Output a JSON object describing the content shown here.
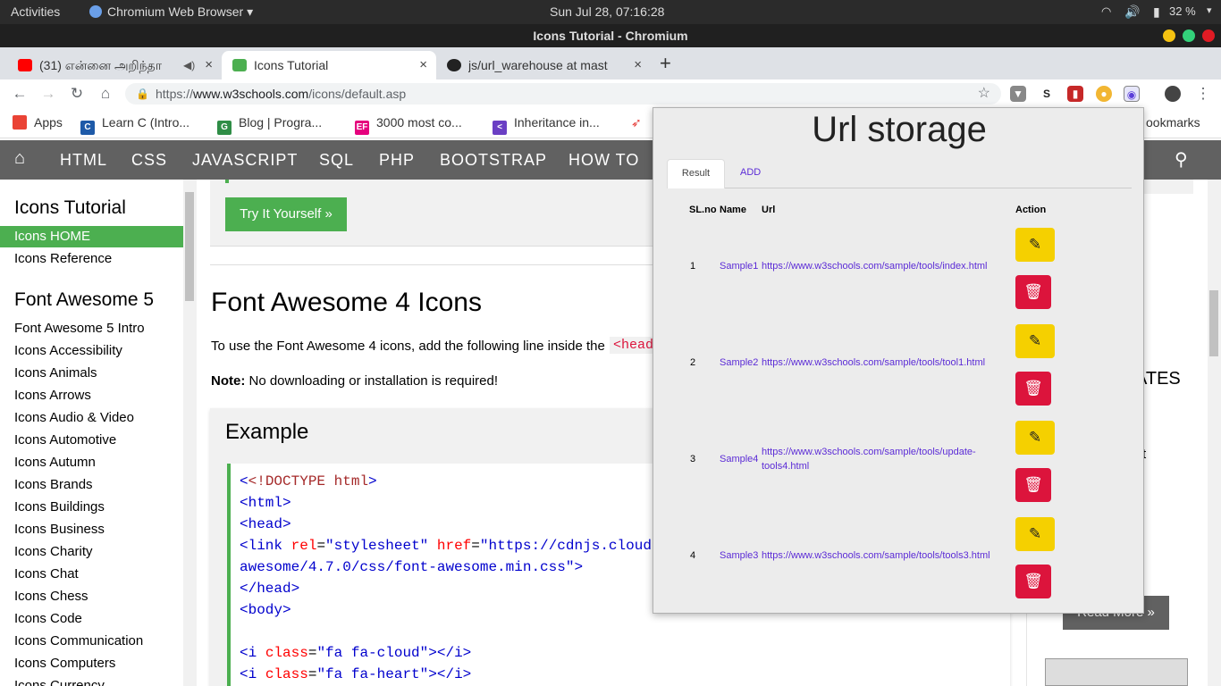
{
  "system": {
    "activities": "Activities",
    "app": "Chromium Web Browser",
    "clock": "Sun Jul 28, 07:16:28",
    "battery": "32 %"
  },
  "window": {
    "title": "Icons Tutorial - Chromium"
  },
  "tabs": [
    {
      "title": "(31) என்னை அறிந்தா",
      "close": "×"
    },
    {
      "title": "Icons Tutorial",
      "close": "×"
    },
    {
      "title": "js/url_warehouse at mast",
      "close": "×"
    }
  ],
  "newtab": "+",
  "omnibox": {
    "scheme": "https://",
    "host": "www.w3schools.com",
    "path": "/icons/default.asp"
  },
  "bookmarks": [
    "Apps",
    "Learn C (Intro...",
    "Blog | Progra...",
    "3000 most co...",
    "Inheritance in...",
    "ookmarks"
  ],
  "w3nav": [
    "HTML",
    "CSS",
    "JAVASCRIPT",
    "SQL",
    "PHP",
    "BOOTSTRAP",
    "HOW TO"
  ],
  "sidebar": {
    "heading1": "Icons Tutorial",
    "items1": [
      "Icons HOME",
      "Icons Reference"
    ],
    "heading2": "Font Awesome 5",
    "items2": [
      "Font Awesome 5 Intro",
      "Icons Accessibility",
      "Icons Animals",
      "Icons Arrows",
      "Icons Audio & Video",
      "Icons Automotive",
      "Icons Autumn",
      "Icons Brands",
      "Icons Buildings",
      "Icons Business",
      "Icons Charity",
      "Icons Chat",
      "Icons Chess",
      "Icons Code",
      "Icons Communication",
      "Icons Computers",
      "Icons Currency"
    ]
  },
  "main": {
    "try_button": "Try It Yourself »",
    "heading": "Font Awesome 4 Icons",
    "intro": "To use the Font Awesome 4 icons, add the following line inside the",
    "intro_code": "<head",
    "note_label": "Note:",
    "note_text": "No downloading or installation is required!",
    "example": "Example",
    "right_partial": {
      "e": "E",
      "ates": "ATES",
      "t": "t",
      "readmore": "Read More »"
    }
  },
  "code": {
    "doctype": "<!DOCTYPE",
    "html_kw": "html",
    "html_open": "<html>",
    "head_open": "<head>",
    "link": "<link",
    "rel": "rel",
    "rel_val": "\"stylesheet\"",
    "href": "href",
    "href_val": "\"https://cdnjs.cloud",
    "line2": "awesome/4.7.0/css/font-awesome.min.css\"",
    "gt": ">",
    "head_close": "</head>",
    "body_open": "<body>",
    "i1": "<i",
    "class": "class",
    "cloud": "\"fa fa-cloud\"",
    "heart": "\"fa fa-heart\"",
    "iclose": "></i>"
  },
  "popup": {
    "title": "Url storage",
    "tab_result": "Result",
    "tab_add": "ADD",
    "headers": [
      "SL.no",
      "Name",
      "Url",
      "Action"
    ],
    "rows": [
      {
        "sl": "1",
        "name": "Sample1",
        "url": "https://www.w3schools.com/sample/tools/index.html"
      },
      {
        "sl": "2",
        "name": "Sample2",
        "url": "https://www.w3schools.com/sample/tools/tool1.html"
      },
      {
        "sl": "3",
        "name": "Sample4",
        "url": "https://www.w3schools.com/sample/tools/update-",
        "url2": "tools4.html"
      },
      {
        "sl": "4",
        "name": "Sample3",
        "url": "https://www.w3schools.com/sample/tools/tools3.html"
      }
    ]
  },
  "icons": {
    "edit": "✎",
    "delete": "🗑"
  }
}
